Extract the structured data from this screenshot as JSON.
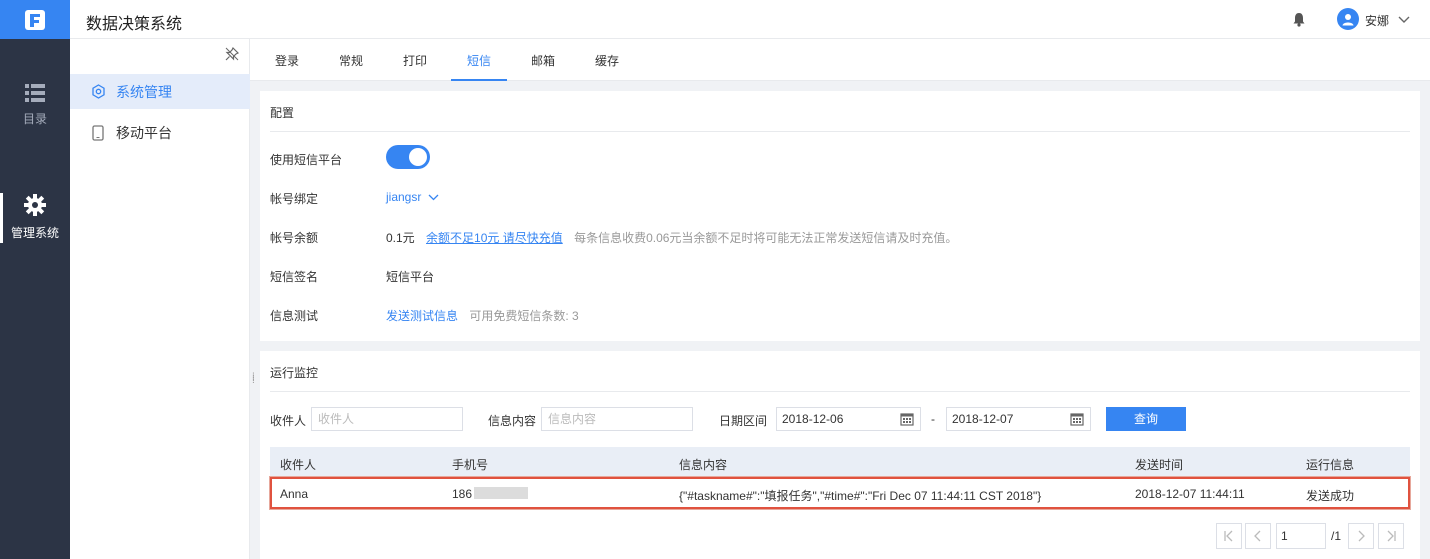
{
  "app": {
    "title": "数据决策系统"
  },
  "user": {
    "name": "安娜"
  },
  "rail": [
    {
      "label": "目录",
      "icon": "list-icon"
    },
    {
      "label": "管理系统",
      "icon": "gear-icon"
    }
  ],
  "submenu": [
    {
      "label": "系统管理",
      "icon": "settings-icon"
    },
    {
      "label": "移动平台",
      "icon": "mobile-icon"
    }
  ],
  "tabs": [
    "登录",
    "常规",
    "打印",
    "短信",
    "邮箱",
    "缓存"
  ],
  "active_tab": "短信",
  "config": {
    "title": "配置",
    "rows": {
      "use_platform": {
        "label": "使用短信平台",
        "enabled": true
      },
      "account": {
        "label": "帐号绑定",
        "value": "jiangsr"
      },
      "balance": {
        "label": "帐号余额",
        "value": "0.1元",
        "link": "余额不足10元 请尽快充值",
        "note": "每条信息收费0.06元当余额不足时将可能无法正常发送短信请及时充值。"
      },
      "signature": {
        "label": "短信签名",
        "value": "短信平台"
      },
      "test": {
        "label": "信息测试",
        "link": "发送测试信息",
        "note": "可用免费短信条数:  3"
      }
    }
  },
  "monitor": {
    "title": "运行监控",
    "filters": {
      "recipient_label": "收件人",
      "recipient_placeholder": "收件人",
      "content_label": "信息内容",
      "content_placeholder": "信息内容",
      "date_label": "日期区间",
      "date_start": "2018-12-06",
      "date_sep": "-",
      "date_end": "2018-12-07",
      "query_button": "查询"
    },
    "columns": [
      "收件人",
      "手机号",
      "信息内容",
      "发送时间",
      "运行信息"
    ],
    "rows": [
      {
        "recipient": "Anna",
        "phone": "186",
        "content": "{\"#taskname#\":\"填报任务\",\"#time#\":\"Fri Dec 07 11:44:11 CST 2018\"}",
        "time": "2018-12-07 11:44:11",
        "status": "发送成功"
      }
    ],
    "pagination": {
      "current": "1",
      "total": "/1"
    }
  },
  "colors": {
    "accent": "#3685f2",
    "rail_bg": "#2c3445",
    "highlight_border": "#e0523f"
  }
}
